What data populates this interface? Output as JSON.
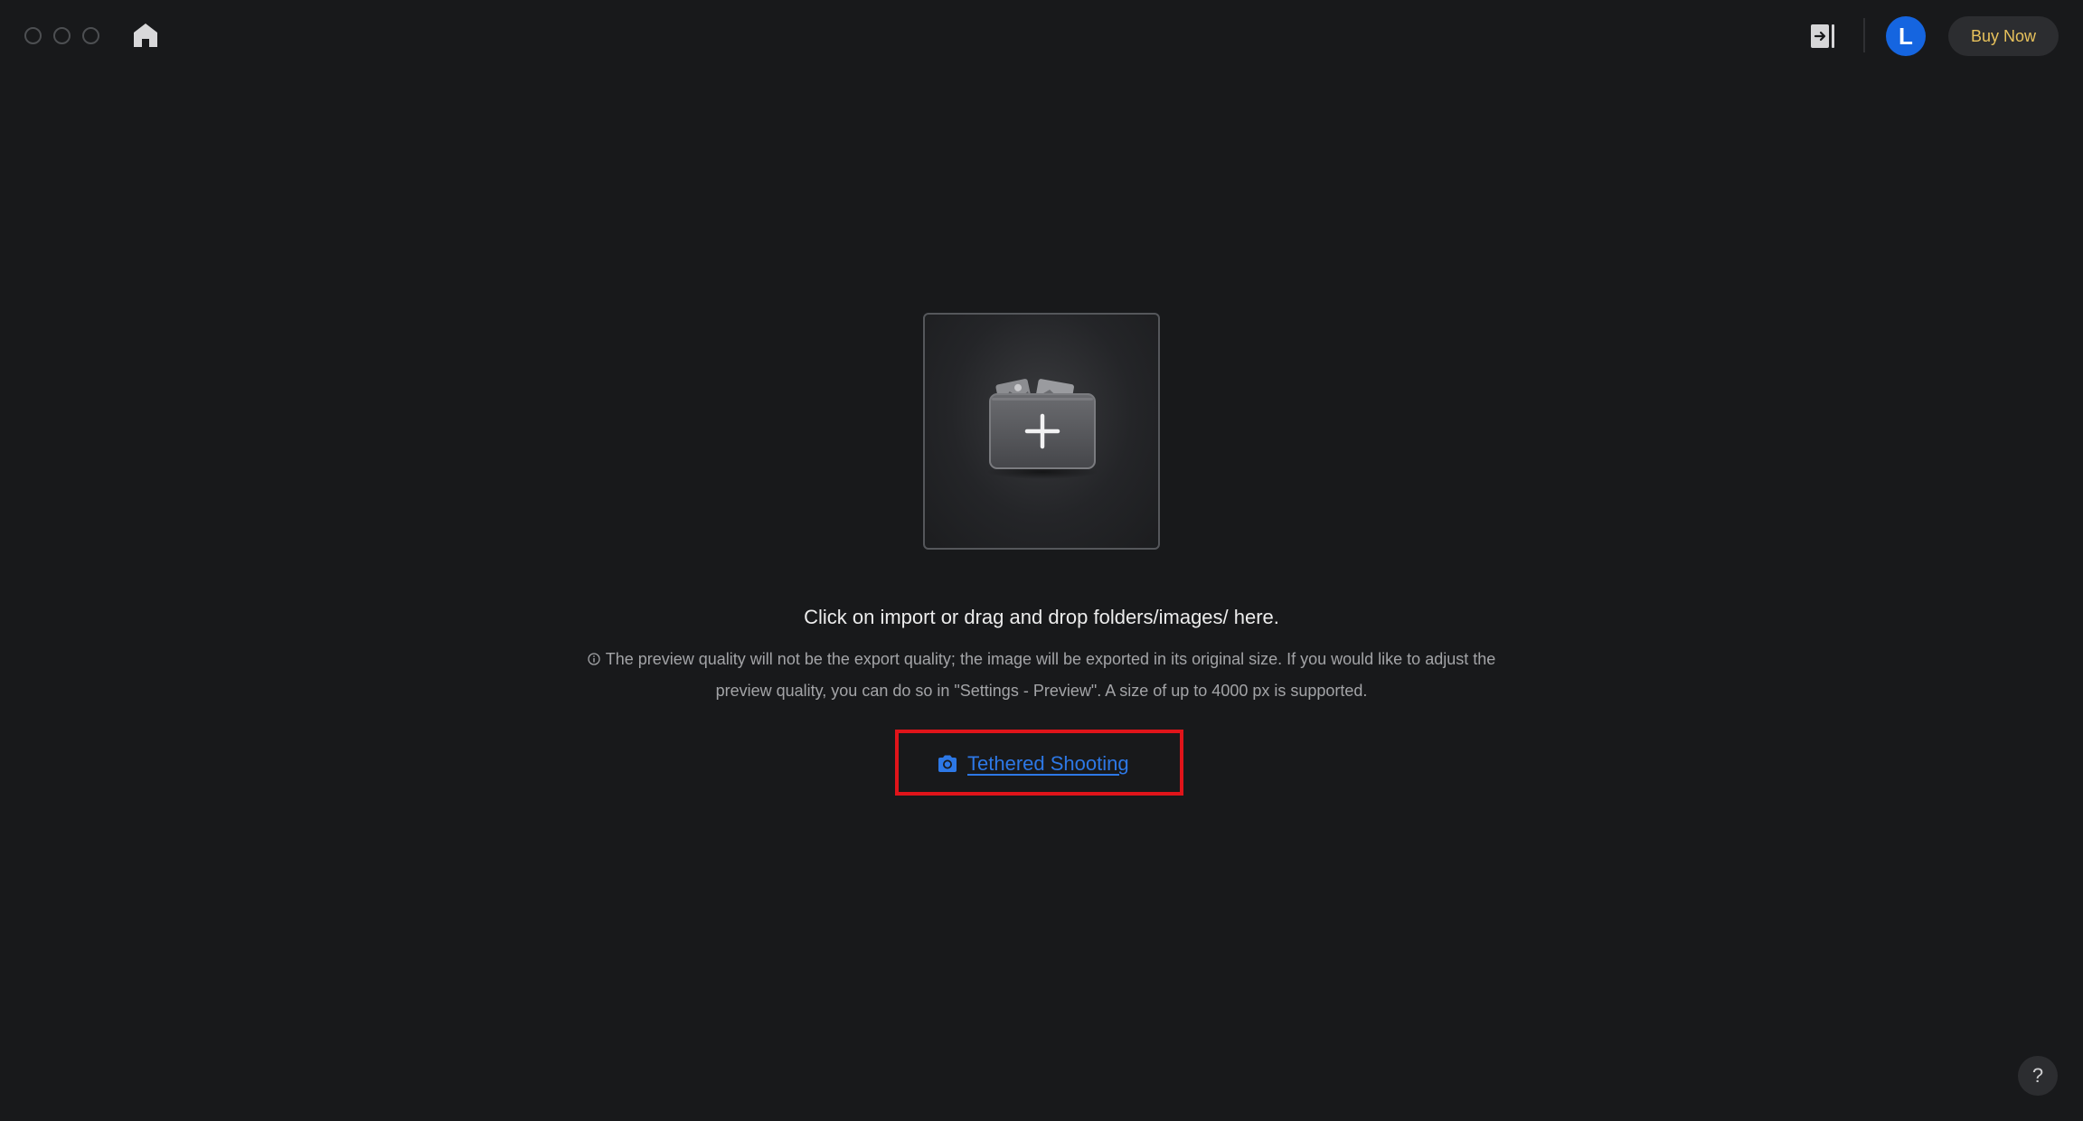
{
  "titlebar": {
    "avatar_letter": "L",
    "buy_now_label": "Buy Now",
    "buy_now_color": "#e8c25c",
    "avatar_color": "#1565e0",
    "icons": [
      "home-icon",
      "exit-sidebar-icon"
    ]
  },
  "main": {
    "import_icon": "folder-add-icon",
    "instruction": "Click on import or drag and drop folders/images/ here.",
    "note_line1": "The preview quality will not be the export quality; the image will be exported in its original size. If you would like to adjust the",
    "note_line2": "preview quality, you can do so in \"Settings - Preview\". A size of up to 4000 px is supported.",
    "tethered_shooting_label": "Tethered Shooting",
    "link_color": "#2d78e6",
    "highlight_color": "#e0141a"
  },
  "help": {
    "label": "?"
  }
}
